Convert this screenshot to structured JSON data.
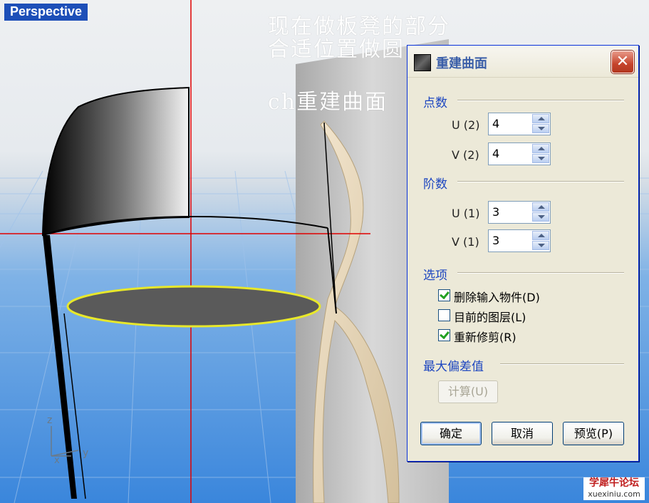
{
  "viewport": {
    "label": "Perspective"
  },
  "overlay_notes": [
    "现在做板凳的部分",
    "合适位置做圆",
    "ch重建曲面"
  ],
  "axis": {
    "z": "z",
    "x": "x",
    "y": "y"
  },
  "dialog": {
    "title": "重建曲面",
    "close_glyph": "✕",
    "point_count": {
      "label": "点数",
      "u_label": "U (2)",
      "u_value": "4",
      "v_label": "V (2)",
      "v_value": "4"
    },
    "degree": {
      "label": "阶数",
      "u_label": "U (1)",
      "u_value": "3",
      "v_label": "V (1)",
      "v_value": "3"
    },
    "options": {
      "label": "选项",
      "items": [
        {
          "label": "删除输入物件(D)",
          "checked": true
        },
        {
          "label": "目前的图层(L)",
          "checked": false
        },
        {
          "label": "重新修剪(R)",
          "checked": true
        }
      ]
    },
    "max_deviation": {
      "label": "最大偏差值",
      "calc_button": "计算(U)"
    },
    "buttons": {
      "ok": "确定",
      "cancel": "取消",
      "preview": "预览(P)"
    }
  },
  "watermark": {
    "line1": "学犀牛论坛",
    "line2": "xuexiniu.com"
  },
  "colors": {
    "dialog_bg": "#ece9d8",
    "group_label": "#1d46c0",
    "title_blue": "#1d4fb8",
    "red_axis": "#e00000",
    "circle_outline": "#e8e82a"
  }
}
